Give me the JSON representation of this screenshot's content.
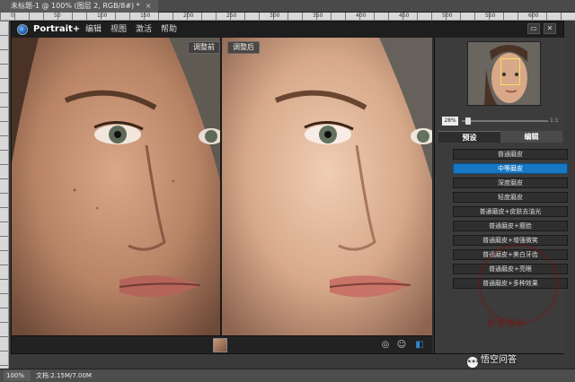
{
  "ps": {
    "tab_title": "未标题-1 @ 100% (图层 2, RGB/8#) *",
    "tab_close": "×",
    "status_zoom": "100%",
    "status_doc": "文档:2.15M/7.00M",
    "ruler_marks": [
      "0",
      "50",
      "100",
      "150",
      "200",
      "250",
      "300",
      "350",
      "400",
      "450",
      "500",
      "550",
      "600"
    ]
  },
  "plugin": {
    "brand": "Portrait+",
    "menu": [
      "编辑",
      "视图",
      "激活",
      "帮助"
    ],
    "win_buttons": [
      "▭",
      "✕"
    ]
  },
  "panes": {
    "before_label": "调整前",
    "after_label": "调整后"
  },
  "bottombar": {
    "icons": [
      "compare-icon",
      "smile-icon",
      "layout-icon"
    ]
  },
  "navigator": {
    "zoom": "28%",
    "zoom_end": "1:1"
  },
  "tabs": [
    {
      "label": "预设",
      "active": true
    },
    {
      "label": "编辑",
      "active": false
    }
  ],
  "presets": [
    {
      "label": "普通磨皮",
      "selected": false
    },
    {
      "label": "中等磨皮",
      "selected": true
    },
    {
      "label": "深度磨皮",
      "selected": false
    },
    {
      "label": "轻度磨皮",
      "selected": false
    },
    {
      "label": "普通磨皮+皮肤去油光",
      "selected": false
    },
    {
      "label": "普通磨皮+瘦脸",
      "selected": false
    },
    {
      "label": "普通磨皮+增强微笑",
      "selected": false
    },
    {
      "label": "普通磨皮+美白牙齿",
      "selected": false
    },
    {
      "label": "普通磨皮+亮眼",
      "selected": false
    },
    {
      "label": "普通磨皮+多种效果",
      "selected": false
    }
  ],
  "watermarks": {
    "seal_text": "紫飘摄影",
    "site_text": "悟空问答"
  },
  "colors": {
    "selected": "#1677c2",
    "panel": "#3c3c3c",
    "menubar": "#1e1e1e"
  }
}
